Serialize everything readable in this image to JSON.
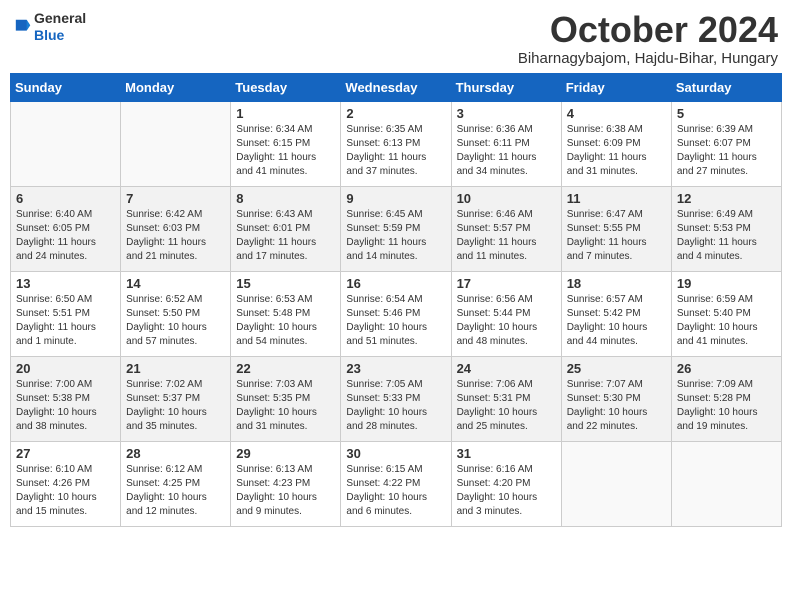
{
  "header": {
    "logo_line1": "General",
    "logo_line2": "Blue",
    "month": "October 2024",
    "location": "Biharnagybajom, Hajdu-Bihar, Hungary"
  },
  "weekdays": [
    "Sunday",
    "Monday",
    "Tuesday",
    "Wednesday",
    "Thursday",
    "Friday",
    "Saturday"
  ],
  "weeks": [
    [
      {
        "day": "",
        "info": ""
      },
      {
        "day": "",
        "info": ""
      },
      {
        "day": "1",
        "info": "Sunrise: 6:34 AM\nSunset: 6:15 PM\nDaylight: 11 hours and 41 minutes."
      },
      {
        "day": "2",
        "info": "Sunrise: 6:35 AM\nSunset: 6:13 PM\nDaylight: 11 hours and 37 minutes."
      },
      {
        "day": "3",
        "info": "Sunrise: 6:36 AM\nSunset: 6:11 PM\nDaylight: 11 hours and 34 minutes."
      },
      {
        "day": "4",
        "info": "Sunrise: 6:38 AM\nSunset: 6:09 PM\nDaylight: 11 hours and 31 minutes."
      },
      {
        "day": "5",
        "info": "Sunrise: 6:39 AM\nSunset: 6:07 PM\nDaylight: 11 hours and 27 minutes."
      }
    ],
    [
      {
        "day": "6",
        "info": "Sunrise: 6:40 AM\nSunset: 6:05 PM\nDaylight: 11 hours and 24 minutes."
      },
      {
        "day": "7",
        "info": "Sunrise: 6:42 AM\nSunset: 6:03 PM\nDaylight: 11 hours and 21 minutes."
      },
      {
        "day": "8",
        "info": "Sunrise: 6:43 AM\nSunset: 6:01 PM\nDaylight: 11 hours and 17 minutes."
      },
      {
        "day": "9",
        "info": "Sunrise: 6:45 AM\nSunset: 5:59 PM\nDaylight: 11 hours and 14 minutes."
      },
      {
        "day": "10",
        "info": "Sunrise: 6:46 AM\nSunset: 5:57 PM\nDaylight: 11 hours and 11 minutes."
      },
      {
        "day": "11",
        "info": "Sunrise: 6:47 AM\nSunset: 5:55 PM\nDaylight: 11 hours and 7 minutes."
      },
      {
        "day": "12",
        "info": "Sunrise: 6:49 AM\nSunset: 5:53 PM\nDaylight: 11 hours and 4 minutes."
      }
    ],
    [
      {
        "day": "13",
        "info": "Sunrise: 6:50 AM\nSunset: 5:51 PM\nDaylight: 11 hours and 1 minute."
      },
      {
        "day": "14",
        "info": "Sunrise: 6:52 AM\nSunset: 5:50 PM\nDaylight: 10 hours and 57 minutes."
      },
      {
        "day": "15",
        "info": "Sunrise: 6:53 AM\nSunset: 5:48 PM\nDaylight: 10 hours and 54 minutes."
      },
      {
        "day": "16",
        "info": "Sunrise: 6:54 AM\nSunset: 5:46 PM\nDaylight: 10 hours and 51 minutes."
      },
      {
        "day": "17",
        "info": "Sunrise: 6:56 AM\nSunset: 5:44 PM\nDaylight: 10 hours and 48 minutes."
      },
      {
        "day": "18",
        "info": "Sunrise: 6:57 AM\nSunset: 5:42 PM\nDaylight: 10 hours and 44 minutes."
      },
      {
        "day": "19",
        "info": "Sunrise: 6:59 AM\nSunset: 5:40 PM\nDaylight: 10 hours and 41 minutes."
      }
    ],
    [
      {
        "day": "20",
        "info": "Sunrise: 7:00 AM\nSunset: 5:38 PM\nDaylight: 10 hours and 38 minutes."
      },
      {
        "day": "21",
        "info": "Sunrise: 7:02 AM\nSunset: 5:37 PM\nDaylight: 10 hours and 35 minutes."
      },
      {
        "day": "22",
        "info": "Sunrise: 7:03 AM\nSunset: 5:35 PM\nDaylight: 10 hours and 31 minutes."
      },
      {
        "day": "23",
        "info": "Sunrise: 7:05 AM\nSunset: 5:33 PM\nDaylight: 10 hours and 28 minutes."
      },
      {
        "day": "24",
        "info": "Sunrise: 7:06 AM\nSunset: 5:31 PM\nDaylight: 10 hours and 25 minutes."
      },
      {
        "day": "25",
        "info": "Sunrise: 7:07 AM\nSunset: 5:30 PM\nDaylight: 10 hours and 22 minutes."
      },
      {
        "day": "26",
        "info": "Sunrise: 7:09 AM\nSunset: 5:28 PM\nDaylight: 10 hours and 19 minutes."
      }
    ],
    [
      {
        "day": "27",
        "info": "Sunrise: 6:10 AM\nSunset: 4:26 PM\nDaylight: 10 hours and 15 minutes."
      },
      {
        "day": "28",
        "info": "Sunrise: 6:12 AM\nSunset: 4:25 PM\nDaylight: 10 hours and 12 minutes."
      },
      {
        "day": "29",
        "info": "Sunrise: 6:13 AM\nSunset: 4:23 PM\nDaylight: 10 hours and 9 minutes."
      },
      {
        "day": "30",
        "info": "Sunrise: 6:15 AM\nSunset: 4:22 PM\nDaylight: 10 hours and 6 minutes."
      },
      {
        "day": "31",
        "info": "Sunrise: 6:16 AM\nSunset: 4:20 PM\nDaylight: 10 hours and 3 minutes."
      },
      {
        "day": "",
        "info": ""
      },
      {
        "day": "",
        "info": ""
      }
    ]
  ]
}
